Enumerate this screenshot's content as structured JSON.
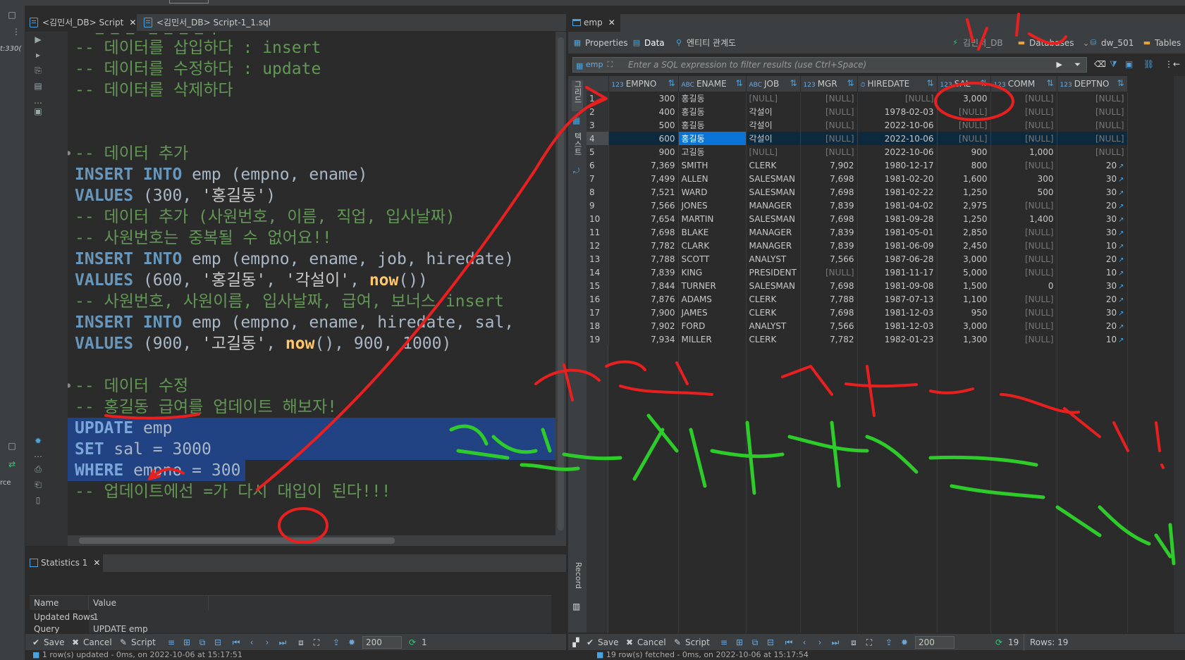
{
  "editor": {
    "tabs": [
      {
        "label": "<김민서_DB> Script"
      },
      {
        "label": "<김민서_DB> Script-1_1.sql"
      }
    ],
    "lines": [
      {
        "text": "-- 데이터를 삽입하다 : insert"
      },
      {
        "text": "-- 데이터를 수정하다 : update"
      },
      {
        "text": "-- 데이터를 삭제하다"
      },
      {
        "text": "-- 데이터 추가"
      },
      {
        "text": "-- 데이터 추가 (사원번호, 이름, 직업, 입사날짜)"
      },
      {
        "text": "-- 사원번호는 중복될 수 없어요!!"
      },
      {
        "text": "-- 사원번호, 사원이름, 입사날짜, 급여, 보너스 insert"
      },
      {
        "text": "-- 데이터 수정"
      },
      {
        "text": "-- 홍길동 급여를 업데이트 해보자!"
      },
      {
        "text": "-- 업데이트에선 =가 다시 대입이 된다!!!"
      }
    ],
    "sql": {
      "insert_into": "INSERT INTO",
      "values_kw": "VALUES",
      "emp_cols_1": " emp (empno, ename)",
      "values_1_a": " (300, ",
      "values_1_b": "'홍길동'",
      "values_1_c": ")",
      "emp_cols_2": " emp (empno, ename, job, hiredate)",
      "values_2_a": " (600, ",
      "values_2_b": "'홍길동'",
      "values_2_c": ", ",
      "values_2_d": "'각설이'",
      "values_2_e": ", ",
      "now": "now",
      "values_2_f": "())",
      "emp_cols_3": " emp (empno, ename, hiredate, sal,",
      "values_3_a": " (900, ",
      "values_3_b": "'고길동'",
      "values_3_c": ", ",
      "values_3_d": "(), 900, 1000)",
      "update_kw": "UPDATE",
      "update_rest": " emp",
      "set_kw": "SET",
      "set_rest": " sal = 3000",
      "where_kw": "WHERE",
      "where_rest": " empno = 300"
    }
  },
  "left_frags": {
    "a": "t:330(",
    "b": "rce"
  },
  "statistics": {
    "tab_label": "Statistics 1",
    "col_name": "Name",
    "col_value": "Value",
    "rows": [
      {
        "name": "Updated Rows",
        "value": "1"
      },
      {
        "name": "Query",
        "value": "UPDATE emp"
      }
    ],
    "status": "1 row(s) updated - 0ms, on 2022-10-06 at 15:17:51"
  },
  "bottombar_left": {
    "save": "Save",
    "cancel": "Cancel",
    "script": "Script",
    "fetch_size": "200",
    "count": "1"
  },
  "right": {
    "tab_label": "emp",
    "toolbar": {
      "properties": "Properties",
      "data": "Data",
      "er": "엔티티 관계도",
      "db": "김민서_DB",
      "databases": "Databases",
      "dw": "dw_501",
      "tables": "Tables"
    },
    "filter": {
      "tag": "emp",
      "placeholder": "Enter a SQL expression to filter results (use Ctrl+Space)"
    },
    "side_tabs": {
      "grid": "그리드",
      "text": "텍스트",
      "record": "Record"
    },
    "columns": [
      {
        "type": "123",
        "name": "EMPNO"
      },
      {
        "type": "ABC",
        "name": "ENAME"
      },
      {
        "type": "ABC",
        "name": "JOB"
      },
      {
        "type": "123",
        "name": "MGR"
      },
      {
        "type": "⏱",
        "name": "HIREDATE"
      },
      {
        "type": "123",
        "name": "SAL"
      },
      {
        "type": "123",
        "name": "COMM"
      },
      {
        "type": "123",
        "name": "DEPTNO"
      }
    ],
    "rows": [
      [
        "1",
        "300",
        "홍길동",
        "[NULL]",
        "[NULL]",
        "[NULL]",
        "3,000",
        "[NULL]",
        "[NULL]"
      ],
      [
        "2",
        "400",
        "홍길동",
        "각설이",
        "[NULL]",
        "1978-02-03",
        "[NULL]",
        "[NULL]",
        "[NULL]"
      ],
      [
        "3",
        "500",
        "홍길동",
        "각설이",
        "[NULL]",
        "2022-10-06",
        "[NULL]",
        "[NULL]",
        "[NULL]"
      ],
      [
        "4",
        "600",
        "홍길동",
        "각설이",
        "[NULL]",
        "2022-10-06",
        "[NULL]",
        "[NULL]",
        "[NULL]"
      ],
      [
        "5",
        "900",
        "고길동",
        "[NULL]",
        "[NULL]",
        "2022-10-06",
        "900",
        "1,000",
        "[NULL]"
      ],
      [
        "6",
        "7,369",
        "SMITH",
        "CLERK",
        "7,902",
        "1980-12-17",
        "800",
        "[NULL]",
        "20"
      ],
      [
        "7",
        "7,499",
        "ALLEN",
        "SALESMAN",
        "7,698",
        "1981-02-20",
        "1,600",
        "300",
        "30"
      ],
      [
        "8",
        "7,521",
        "WARD",
        "SALESMAN",
        "7,698",
        "1981-02-22",
        "1,250",
        "500",
        "30"
      ],
      [
        "9",
        "7,566",
        "JONES",
        "MANAGER",
        "7,839",
        "1981-04-02",
        "2,975",
        "[NULL]",
        "20"
      ],
      [
        "10",
        "7,654",
        "MARTIN",
        "SALESMAN",
        "7,698",
        "1981-09-28",
        "1,250",
        "1,400",
        "30"
      ],
      [
        "11",
        "7,698",
        "BLAKE",
        "MANAGER",
        "7,839",
        "1981-05-01",
        "2,850",
        "[NULL]",
        "30"
      ],
      [
        "12",
        "7,782",
        "CLARK",
        "MANAGER",
        "7,839",
        "1981-06-09",
        "2,450",
        "[NULL]",
        "10"
      ],
      [
        "13",
        "7,788",
        "SCOTT",
        "ANALYST",
        "7,566",
        "1987-06-28",
        "3,000",
        "[NULL]",
        "20"
      ],
      [
        "14",
        "7,839",
        "KING",
        "PRESIDENT",
        "[NULL]",
        "1981-11-17",
        "5,000",
        "[NULL]",
        "10"
      ],
      [
        "15",
        "7,844",
        "TURNER",
        "SALESMAN",
        "7,698",
        "1981-09-08",
        "1,500",
        "0",
        "30"
      ],
      [
        "16",
        "7,876",
        "ADAMS",
        "CLERK",
        "7,788",
        "1987-07-13",
        "1,100",
        "[NULL]",
        "20"
      ],
      [
        "17",
        "7,900",
        "JAMES",
        "CLERK",
        "7,698",
        "1981-12-03",
        "950",
        "[NULL]",
        "30"
      ],
      [
        "18",
        "7,902",
        "FORD",
        "ANALYST",
        "7,566",
        "1981-12-03",
        "3,000",
        "[NULL]",
        "20"
      ],
      [
        "19",
        "7,934",
        "MILLER",
        "CLERK",
        "7,782",
        "1982-01-23",
        "1,300",
        "[NULL]",
        "10"
      ]
    ],
    "selected_row": 4,
    "bottombar": {
      "save": "Save",
      "cancel": "Cancel",
      "script": "Script",
      "fetch_size": "200",
      "count": "19",
      "rows_label": "Rows: 19"
    },
    "status": "19 row(s) fetched - 0ms, on 2022-10-06 at 15:17:54"
  },
  "annotations": {
    "red_handwriting": "이름같은 사람이 생기잖아!",
    "green_handwriting": "중복안되는 사원번호로 특정한다",
    "colors": {
      "red": "#e8201f",
      "green": "#2ecc2a"
    }
  }
}
